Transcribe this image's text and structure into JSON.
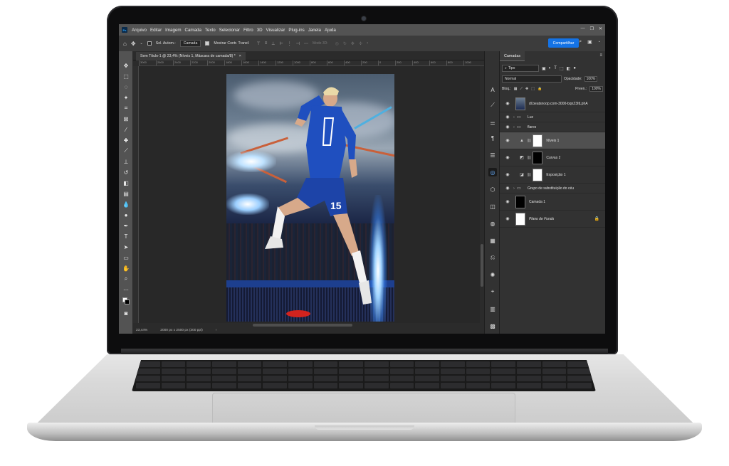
{
  "app": {
    "logo": "Ps"
  },
  "menu": [
    "Arquivo",
    "Editar",
    "Imagem",
    "Camada",
    "Texto",
    "Selecionar",
    "Filtro",
    "3D",
    "Visualizar",
    "Plug-ins",
    "Janela",
    "Ajuda"
  ],
  "options_bar": {
    "auto_select_label": "Sel. Autom.:",
    "auto_select_value": "Camada",
    "transform_controls_label": "Mostrar Contr. Transf.",
    "mode_3d_label": "Modo 3D:",
    "share_label": "Compartilhar"
  },
  "document": {
    "tab_title": "Sem Título-1 @ 23,4% (Níveis 1, Máscara de camada/8) *",
    "close": "×",
    "zoom": "23,44%",
    "size": "2000 px x 2500 px (300 ppi)"
  },
  "ruler": [
    "3000",
    "2600",
    "2400",
    "2200",
    "2000",
    "1800",
    "1600",
    "1400",
    "1200",
    "1000",
    "800",
    "600",
    "400",
    "200",
    "0",
    "200",
    "400",
    "600",
    "800",
    "1000"
  ],
  "tools": [
    "move-icon",
    "marquee-icon",
    "lasso-icon",
    "magic-wand-icon",
    "crop-icon",
    "frame-icon",
    "eyedropper-icon",
    "healing-icon",
    "brush-icon",
    "stamp-icon",
    "history-brush-icon",
    "eraser-icon",
    "gradient-icon",
    "blur-icon",
    "dodge-icon",
    "pen-icon",
    "type-icon",
    "path-select-icon",
    "rectangle-icon",
    "hand-icon",
    "zoom-icon",
    "more-icon"
  ],
  "layers_panel": {
    "tab": "Camadas",
    "filter_kind": "Tipo",
    "blend_mode": "Normal",
    "opacity_label": "Opacidade:",
    "opacity_value": "100%",
    "lock_label": "Bloq.:",
    "fill_label": "Preen.:",
    "fill_value": "100%",
    "layers": [
      {
        "name": "dl.beatsnoop.com-3000-bqnZ3ItLphA",
        "kind": "image",
        "visible": true
      },
      {
        "name": "Luz",
        "kind": "group",
        "visible": true
      },
      {
        "name": "flares",
        "kind": "group",
        "visible": true
      },
      {
        "name": "Níveis 1",
        "kind": "adjustment",
        "visible": true,
        "selected": true,
        "mask": "white"
      },
      {
        "name": "Curvas 2",
        "kind": "adjustment",
        "visible": true,
        "mask": "black"
      },
      {
        "name": "Exposição 1",
        "kind": "adjustment",
        "visible": true,
        "mask": "white"
      },
      {
        "name": "Grupo de substituição do céu",
        "kind": "group",
        "visible": true
      },
      {
        "name": "Camada 1",
        "kind": "image",
        "visible": true
      },
      {
        "name": "Plano de Fundo",
        "kind": "background",
        "visible": true,
        "locked": true
      }
    ]
  },
  "colors": {
    "accent": "#1473e6",
    "menubar": "#535353",
    "panel": "#323232",
    "canvas": "#282828",
    "jersey": "#1f4fbf"
  }
}
